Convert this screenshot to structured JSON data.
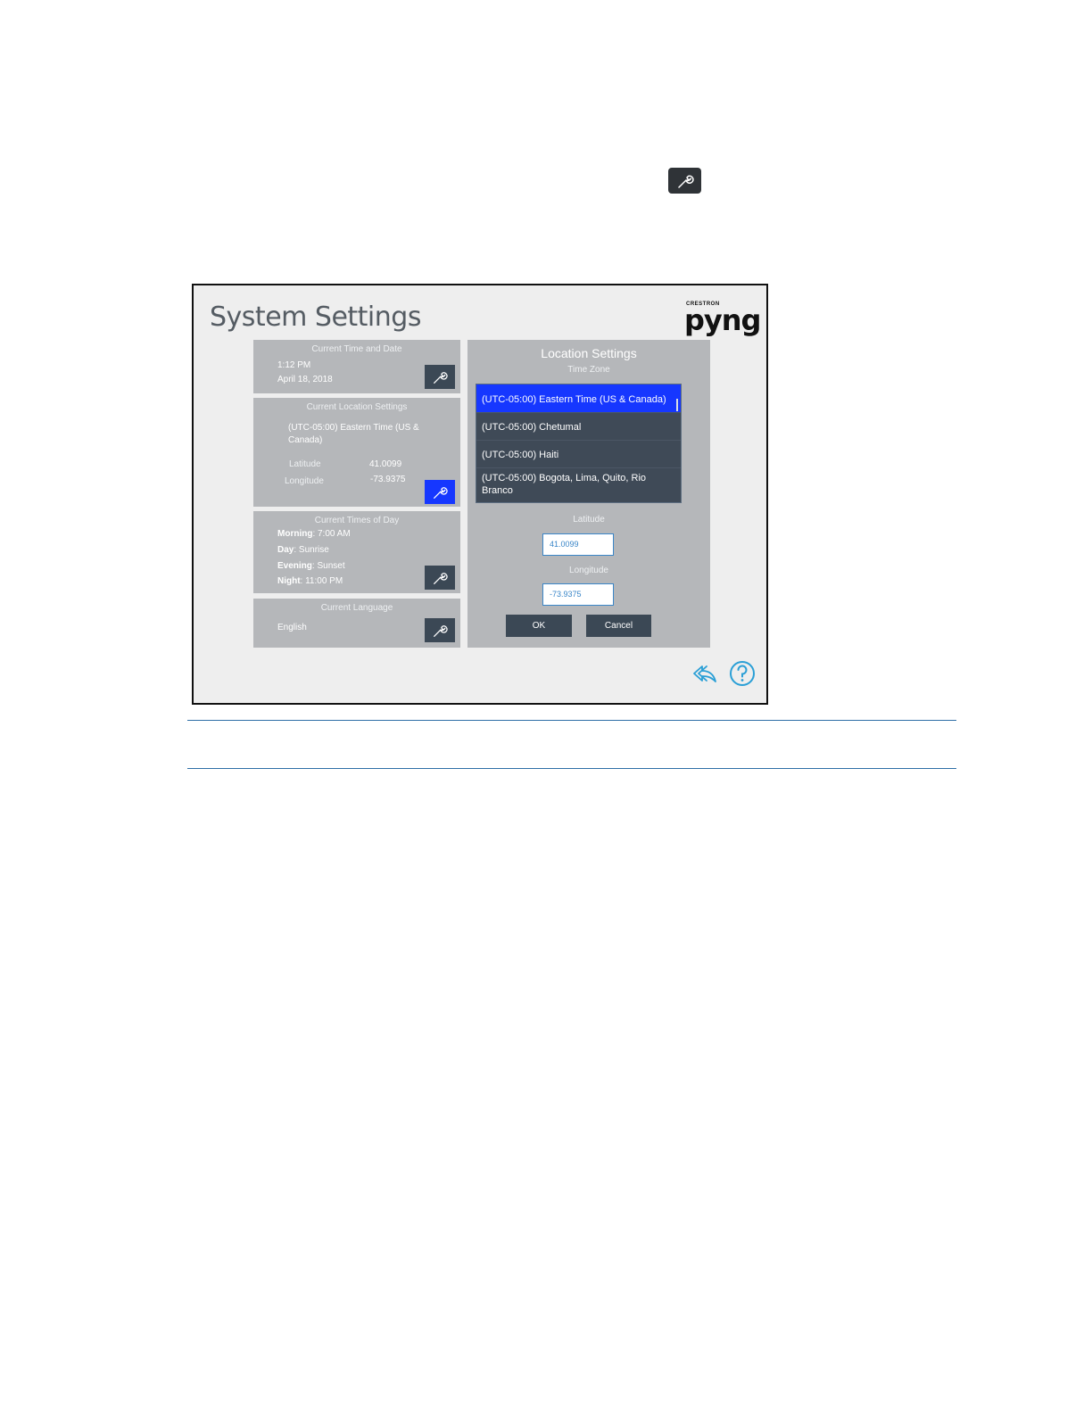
{
  "screen": {
    "title": "System Settings",
    "logo": {
      "brand_small": "CRESTRON",
      "brand_main": "pyng"
    }
  },
  "time_panel": {
    "title": "Current Time and Date",
    "time": "1:12 PM",
    "date": "April 18, 2018"
  },
  "location_panel": {
    "title": "Current Location Settings",
    "timezone_line1": "(UTC-05:00) Eastern Time (US &",
    "timezone_line2": "Canada)",
    "latitude_label": "Latitude",
    "latitude_value": "41.0099",
    "longitude_label": "Longitude",
    "longitude_value": "-73.9375"
  },
  "times_panel": {
    "title": "Current Times of Day",
    "morning_label": "Morning",
    "morning_value": ": 7:00 AM",
    "day_label": "Day",
    "day_value": ": Sunrise",
    "evening_label": "Evening",
    "evening_value": ": Sunset",
    "night_label": "Night",
    "night_value": ": 11:00 PM"
  },
  "language_panel": {
    "title": "Current Language",
    "value": "English"
  },
  "location_dialog": {
    "title": "Location Settings",
    "timezone_label": "Time Zone",
    "timezones": [
      "(UTC-05:00) Eastern Time (US & Canada)",
      "(UTC-05:00) Chetumal",
      "(UTC-05:00) Haiti",
      "(UTC-05:00) Bogota, Lima, Quito, Rio",
      "Branco"
    ],
    "selected_index": 0,
    "latitude_label": "Latitude",
    "latitude_value": "41.0099",
    "longitude_label": "Longitude",
    "longitude_value": "-73.9375",
    "ok_label": "OK",
    "cancel_label": "Cancel"
  },
  "colors": {
    "panel": "#b5b7ba",
    "button_dark": "#3b4855",
    "selected_blue": "#1637ff",
    "icon_blue": "#2a9fd6"
  },
  "icons": [
    "wrench-icon",
    "back-arrow-icon",
    "help-icon"
  ]
}
